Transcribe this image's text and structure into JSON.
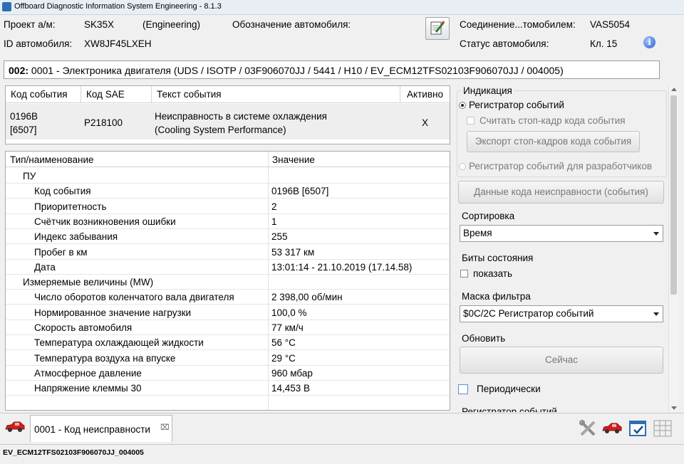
{
  "window": {
    "title": "Offboard Diagnostic Information System Engineering - 8.1.3"
  },
  "header": {
    "project_label": "Проект а/м:",
    "project_value": "SK35X",
    "project_mode": "(Engineering)",
    "vehicle_designation_label": "Обозначение автомобиля:",
    "vehicle_id_label": "ID автомобиля:",
    "vehicle_id_value": "XW8JF45LXEH",
    "connection_label": "Соединение...томобилем:",
    "connection_value": "VAS5054",
    "vehicle_status_label": "Статус автомобиля:",
    "vehicle_status_value": "Кл. 15"
  },
  "ecu": {
    "number": "002:",
    "description": " 0001 - Электроника двигателя  (UDS / ISOTP / 03F906070JJ / 5441 / H10 / EV_ECM12TFS02103F906070JJ / 004005)"
  },
  "event_table": {
    "columns": [
      "Код события",
      "Код SAE",
      "Текст события",
      "Активно"
    ],
    "rows": [
      {
        "code_line1": "0196B",
        "code_line2": "[6507]",
        "sae": "P218100",
        "text_line1": "Неисправность в системе охлаждения",
        "text_line2": "(Cooling System Performance)",
        "active": "X"
      }
    ]
  },
  "details": {
    "columns": [
      "Тип/наименование",
      "Значение"
    ],
    "rows": [
      {
        "name": "ПУ",
        "value": "",
        "level": 1
      },
      {
        "name": "Код события",
        "value": "0196B [6507]",
        "level": 2
      },
      {
        "name": "Приоритетность",
        "value": "2",
        "level": 2
      },
      {
        "name": "Счётчик возникновения ошибки",
        "value": "1",
        "level": 2
      },
      {
        "name": "Индекс забывания",
        "value": "255",
        "level": 2
      },
      {
        "name": "Пробег в км",
        "value": "53 317 км",
        "level": 2
      },
      {
        "name": "Дата",
        "value": "13:01:14 - 21.10.2019  (17.14.58)",
        "level": 2
      },
      {
        "name": "Измеряемые величины (MW)",
        "value": "",
        "level": 1
      },
      {
        "name": "Число оборотов коленчатого вала двигателя",
        "value": "2 398,00 об/мин",
        "level": 2
      },
      {
        "name": "Нормированное значение нагрузки",
        "value": "100,0 %",
        "level": 2
      },
      {
        "name": "Скорость автомобиля",
        "value": "77 км/ч",
        "level": 2
      },
      {
        "name": "Температура охлаждающей жидкости",
        "value": "56 °C",
        "level": 2
      },
      {
        "name": "Температура воздуха на впуске",
        "value": "29 °C",
        "level": 2
      },
      {
        "name": "Атмосферное давление",
        "value": "960 мбар",
        "level": 2
      },
      {
        "name": "Напряжение клеммы 30",
        "value": "14,453 В",
        "level": 2
      }
    ]
  },
  "right_panel": {
    "indication_label": "Индикация",
    "event_recorder_label": "Регистратор событий",
    "read_freeze_frame_label": "Считать стоп-кадр кода события",
    "export_freeze_frames_label": "Экспорт стоп-кадров кода события",
    "dev_event_recorder_label": "Регистратор событий для разработчиков",
    "fault_code_data_label": "Данные кода неисправности (события)",
    "sorting_label": "Сортировка",
    "sorting_value": "Время",
    "status_bits_label": "Биты состояния",
    "show_label": "показать",
    "filter_mask_label": "Маска фильтра",
    "filter_mask_value": "$0C/2C Регистратор событий",
    "update_label": "Обновить",
    "now_label": "Сейчас",
    "periodic_label": "Периодически",
    "event_recorder_cut_label": "Регистратор событий"
  },
  "tabs": [
    {
      "label": "0001 - Код неисправности"
    }
  ],
  "status_bar": {
    "text": "EV_ECM12TFS02103F906070JJ_004005"
  },
  "icons": {
    "car": "car-icon",
    "edit": "edit-icon",
    "info": "info-icon",
    "close": "close-icon",
    "tools": "tools-icon",
    "checklist": "checklist-icon",
    "grid": "grid-icon"
  },
  "colors": {
    "car_red": "#d21e1e",
    "info_blue": "#2c5fc7",
    "title_bar": "#e9eef5"
  }
}
